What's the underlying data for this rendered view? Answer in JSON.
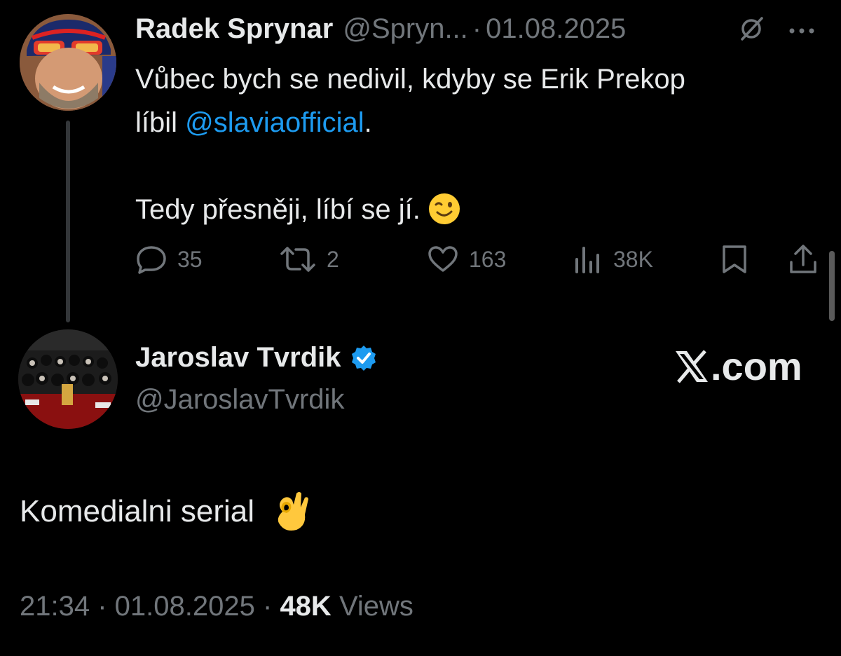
{
  "parent_tweet": {
    "author_name": "Radek Sprynar",
    "handle": "@Spryn...",
    "separator": "·",
    "date": "01.08.2025",
    "text_lines": [
      "Vůbec bych se nedivil, kdyby se Erik Prekop",
      "líbil ",
      "",
      "Tedy přesněji, líbí se jí."
    ],
    "mention": "@slaviaofficial",
    "mention_suffix": ".",
    "stats": {
      "replies": "35",
      "reposts": "2",
      "likes": "163",
      "views": "38K"
    }
  },
  "reply_tweet": {
    "author_name": "Jaroslav Tvrdik",
    "handle": "@JaroslavTvrdik",
    "text": "Komedialni serial",
    "time": "21:34",
    "date": "01.08.2025",
    "views_count": "48K",
    "views_label": "Views"
  },
  "watermark": {
    "suffix": ".com"
  },
  "colors": {
    "background": "#000000",
    "text": "#e7e9ea",
    "muted": "#71767b",
    "link": "#1d9bf0",
    "verified": "#1d9bf0"
  }
}
